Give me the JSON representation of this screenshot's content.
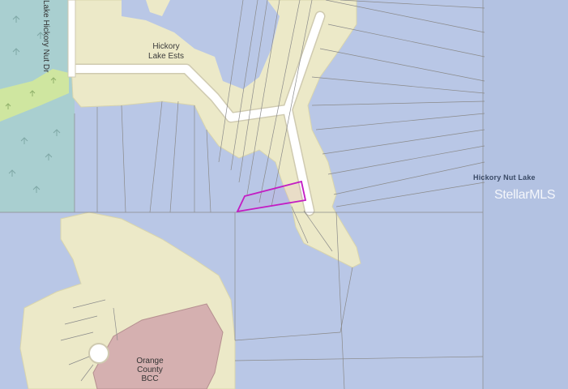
{
  "map": {
    "road_label": "Lake Hickory Nut Dr",
    "subdivision_label_line1": "Hickory",
    "subdivision_label_line2": "Lake Ests",
    "lake_label": "Hickory Nut Lake",
    "owner_label_line1": "Orange",
    "owner_label_line2": "County",
    "owner_label_line3": "BCC",
    "watermark": "StellarMLS",
    "colors": {
      "water": "#b9c7e6",
      "land": "#ece9c8",
      "wetland": "#a9cfd0",
      "park": "#cfe6a0",
      "county_parcel": "#d5b0b0",
      "road": "#ffffff",
      "parcel_lines": "#8a8a8a",
      "highlight": "#c31cc3"
    }
  }
}
